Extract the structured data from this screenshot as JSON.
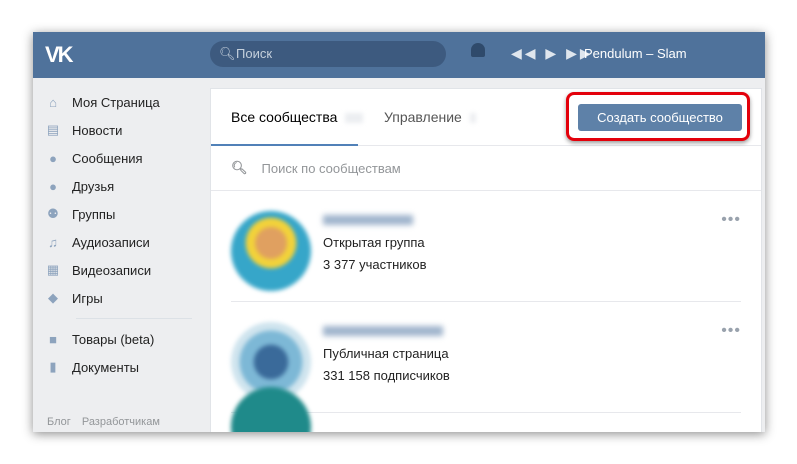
{
  "header": {
    "logo": "VK",
    "search_placeholder": "Поиск",
    "track": "Pendulum – Slam",
    "player_controls": "◀◀ ▶ ▶▶"
  },
  "sidebar": {
    "items": [
      {
        "label": "Моя Страница",
        "icon": "home-icon"
      },
      {
        "label": "Новости",
        "icon": "news-icon"
      },
      {
        "label": "Сообщения",
        "icon": "messages-icon"
      },
      {
        "label": "Друзья",
        "icon": "friends-icon"
      },
      {
        "label": "Группы",
        "icon": "groups-icon"
      },
      {
        "label": "Аудиозаписи",
        "icon": "music-icon"
      },
      {
        "label": "Видеозаписи",
        "icon": "video-icon"
      },
      {
        "label": "Игры",
        "icon": "games-icon"
      }
    ],
    "items2": [
      {
        "label": "Товары (beta)",
        "icon": "bag-icon"
      },
      {
        "label": "Документы",
        "icon": "document-icon"
      }
    ],
    "footer": [
      "Блог",
      "Разработчикам"
    ]
  },
  "main": {
    "tabs": [
      {
        "label": "Все сообщества"
      },
      {
        "label": "Управление"
      }
    ],
    "create_button": "Создать сообщество",
    "search_placeholder": "Поиск по сообществам",
    "groups": [
      {
        "type": "Открытая группа",
        "count": "3 377 участников"
      },
      {
        "type": "Публичная страница",
        "count": "331 158 подписчиков"
      }
    ]
  },
  "colors": {
    "header": "#4f729b",
    "button": "#5e81a8",
    "highlight": "#e3000b"
  }
}
